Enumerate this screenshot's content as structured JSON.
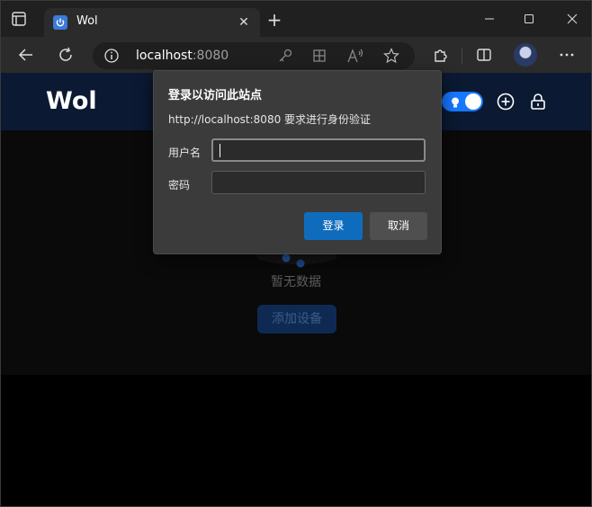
{
  "browser": {
    "tab": {
      "title": "Wol"
    },
    "address": {
      "host": "localhost",
      "port": ":8080"
    }
  },
  "app": {
    "logo": "Wol",
    "empty_text": "暂无数据",
    "add_button": "添加设备"
  },
  "dialog": {
    "title": "登录以访问此站点",
    "message": "http://localhost:8080 要求进行身份验证",
    "username_label": "用户名",
    "password_label": "密码",
    "username_value": "",
    "password_value": "",
    "login_button": "登录",
    "cancel_button": "取消"
  },
  "colors": {
    "accent": "#0f6cbd",
    "app_header": "#0b1932",
    "toggle": "#1677ff"
  }
}
